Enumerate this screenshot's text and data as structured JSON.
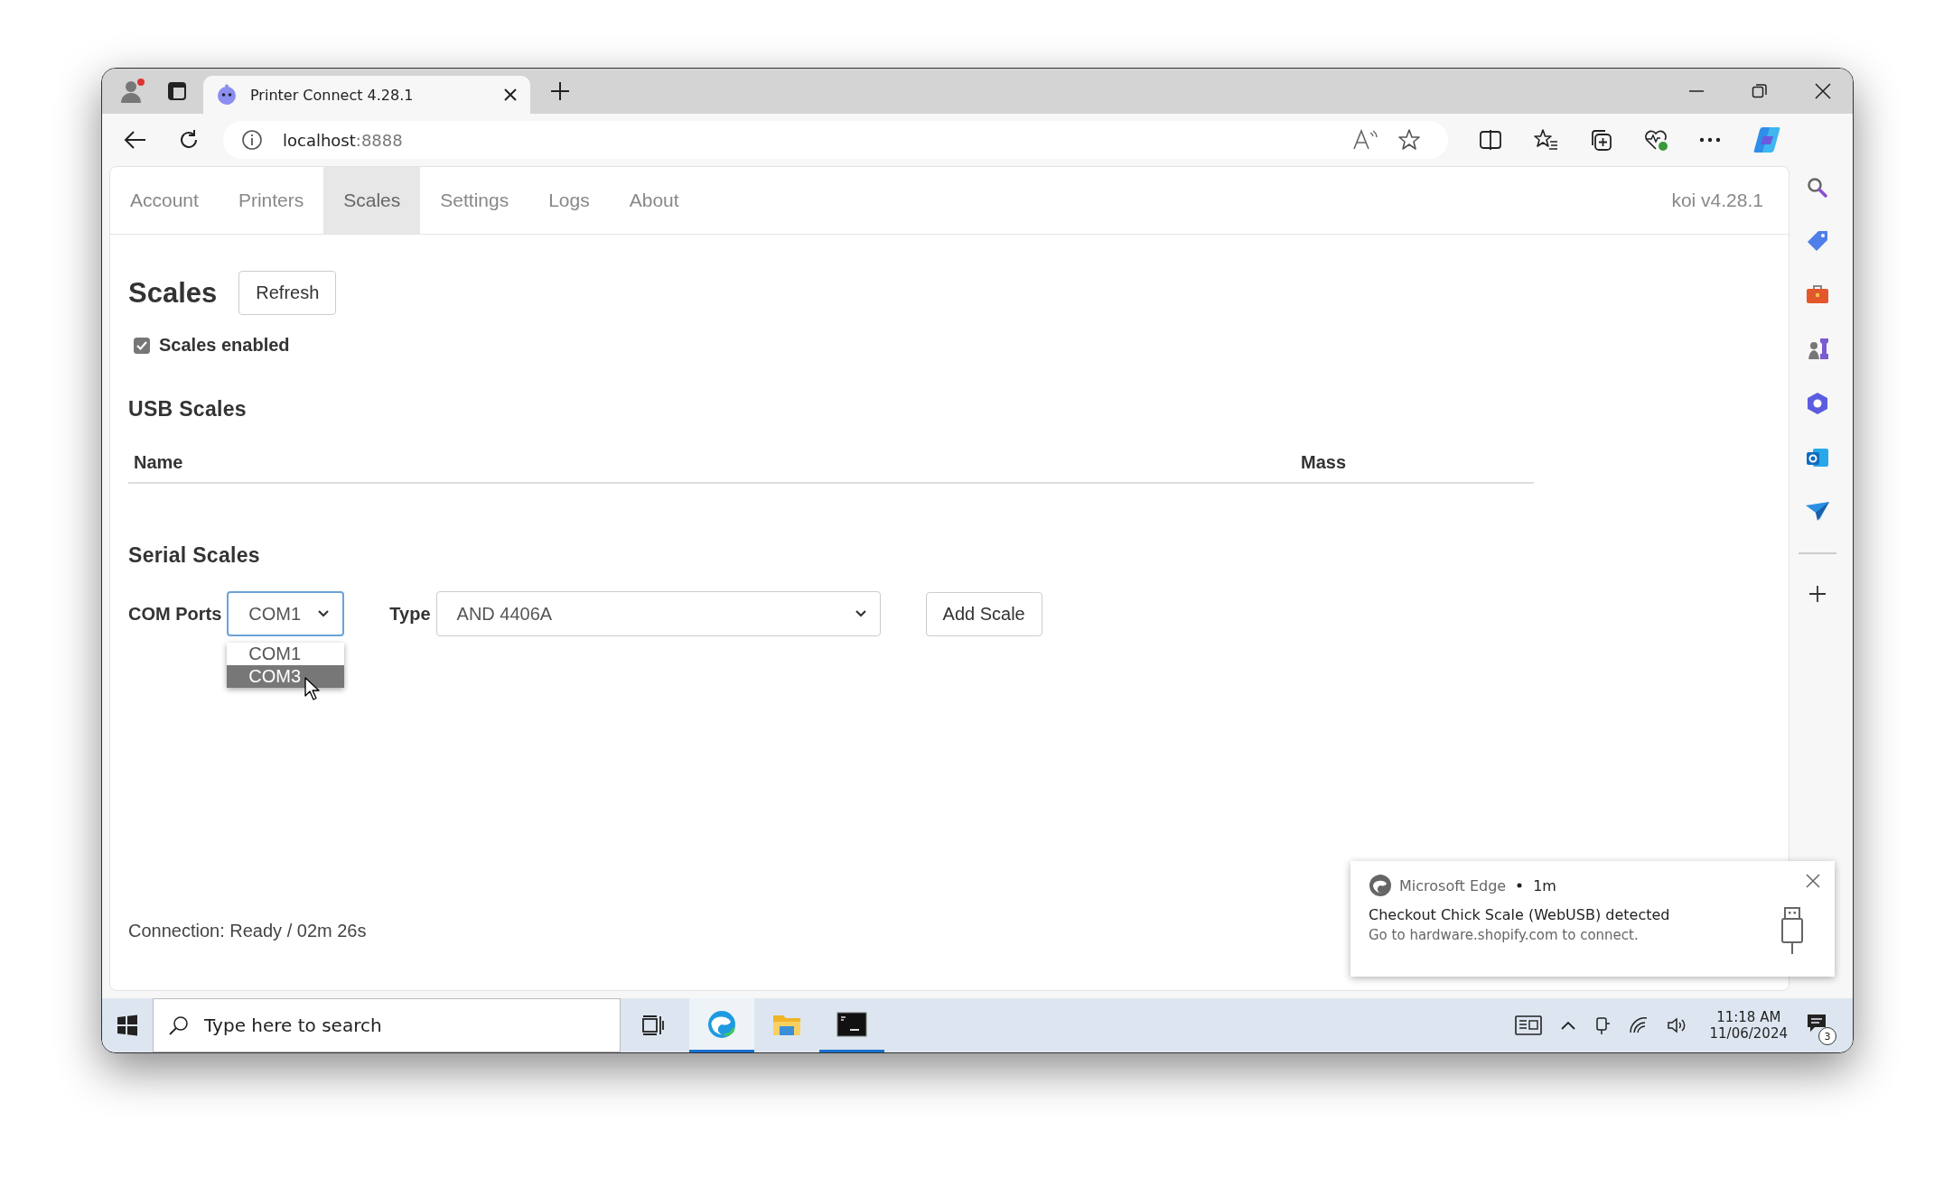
{
  "browser": {
    "tab_title": "Printer Connect 4.28.1",
    "address_host": "localhost",
    "address_port": ":8888"
  },
  "nav": {
    "tabs": [
      {
        "label": "Account",
        "selected": false
      },
      {
        "label": "Printers",
        "selected": false
      },
      {
        "label": "Scales",
        "selected": true
      },
      {
        "label": "Settings",
        "selected": false
      },
      {
        "label": "Logs",
        "selected": false
      },
      {
        "label": "About",
        "selected": false
      }
    ],
    "version": "koi v4.28.1"
  },
  "page": {
    "title": "Scales",
    "refresh_button": "Refresh",
    "scales_enabled": {
      "label": "Scales enabled",
      "checked": true
    },
    "usb_section": {
      "title": "USB Scales",
      "columns": [
        "Name",
        "Mass"
      ]
    },
    "serial_section": {
      "title": "Serial Scales",
      "com_label": "COM Ports",
      "com_value": "COM1",
      "com_options": [
        {
          "label": "COM1",
          "selected": false
        },
        {
          "label": "COM3",
          "selected": true
        }
      ],
      "type_label": "Type",
      "type_value": "AND 4406A",
      "add_button": "Add Scale"
    },
    "connection_status": "Connection: Ready / 02m 26s"
  },
  "notification": {
    "app": "Microsoft Edge",
    "time": "1m",
    "title": "Checkout Chick Scale (WebUSB) detected",
    "body": "Go to hardware.shopify.com to connect."
  },
  "taskbar": {
    "search_placeholder": "Type here to search",
    "apps": [
      {
        "kind": "edge",
        "running": true
      },
      {
        "kind": "folder",
        "running": false
      },
      {
        "kind": "terminal",
        "running": true
      }
    ],
    "time": "11:18 AM",
    "date": "11/06/2024",
    "notification_count": "3"
  }
}
